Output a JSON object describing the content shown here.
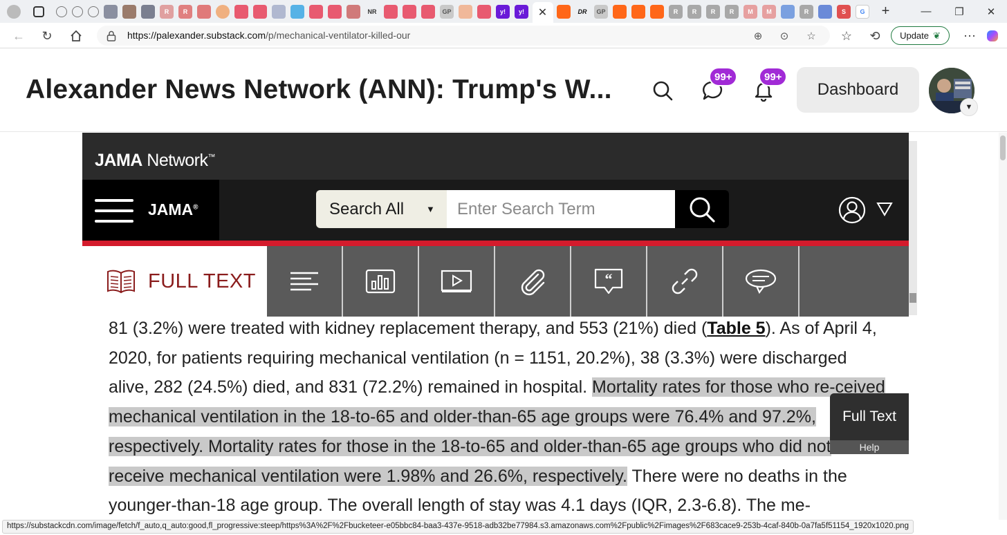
{
  "browser": {
    "url_host": "https://palexander.substack.com",
    "url_path": "/p/mechanical-ventilator-killed-our",
    "update_label": "Update",
    "tab_favicon_labels": [
      "R",
      "R",
      "NR",
      "GP",
      "R",
      "GP",
      "R",
      "R",
      "R",
      "R",
      "M",
      "M",
      "R",
      "S",
      "G"
    ],
    "colors": {
      "tabstrip": "#eef0f3",
      "update_border": "#1f7a3f"
    }
  },
  "page": {
    "title": "Alexander News Network (ANN): Trump's W...",
    "chat_badge": "99+",
    "notif_badge": "99+",
    "dashboard_label": "Dashboard",
    "badge_color": "#a12ad6"
  },
  "jama": {
    "brand_bold": "JAMA",
    "brand_light": " Network",
    "brand_tm": "™",
    "logo_word": "JAMA",
    "logo_reg": "®",
    "search_scope": "Search All",
    "search_placeholder": "Enter Search Term",
    "fulltext_label": "FULL TEXT",
    "float_label": "Full Text",
    "float_help": "Help",
    "accent_red": "#d41b2c",
    "fulltext_color": "#8a1c1c"
  },
  "article": {
    "p_start": "81 (3.2%) were treated with kidney replacement therapy, and 553 (21%) died (",
    "table_link": "Table 5",
    "p_mid": "). As of April 4, 2020, for patients requiring mechanical ventilation (n = 1151, 20.2%), 38 (3.3%) were discharged alive, 282 (24.5%) died, and 831 (72.2%) remained in hospital. ",
    "highlighted": "Mortality rates for those who re-ceived mechanical ventilation in the 18-to-65 and older-than-65 age groups were 76.4% and 97.2%, respectively. Mortality rates for those in the 18-to-65 and older-than-65 age groups who did not receive mechanical ventilation were 1.98% and 26.6%, respectively.",
    "p_end": " There were no deaths in the younger-than-18 age group. The overall length of stay was 4.1 days (IQR, 2.3-6.8). The me-"
  },
  "status_url": "https://substackcdn.com/image/fetch/f_auto,q_auto:good,fl_progressive:steep/https%3A%2F%2Fbucketeer-e05bbc84-baa3-437e-9518-adb32be77984.s3.amazonaws.com%2Fpublic%2Fimages%2F683cace9-253b-4caf-840b-0a7fa5f51154_1920x1020.png"
}
